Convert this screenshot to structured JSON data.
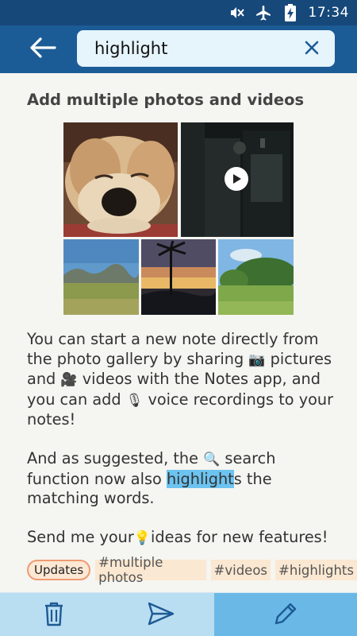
{
  "status_bar": {
    "time": "17:34",
    "icons": [
      "mute-icon",
      "airplane-mode-icon",
      "battery-charging-icon"
    ]
  },
  "search": {
    "value": "highlight",
    "back_icon": "arrow-left-icon",
    "clear_icon": "close-icon"
  },
  "note": {
    "title": "Add multiple photos and videos",
    "photos": [
      "dog-photo",
      "video-thumbnail",
      "mountain-landscape-photo",
      "sunset-palm-photo",
      "tropical-field-photo"
    ],
    "paragraph1": {
      "a": "You can start a new note directly from the photo gallery by sharing ",
      "camera_emoji": "📷",
      "b": " pictures and ",
      "film_emoji": "🎥",
      "c": " videos with the Notes app, and you can add ",
      "mic_emoji": "🎙",
      "d": " voice recordings to your notes!"
    },
    "paragraph2": {
      "a": "And as suggested, the ",
      "search_emoji": "🔍",
      "b": " search function now also ",
      "highlight": "highlight",
      "c": "s the matching words."
    },
    "paragraph3": {
      "a": "Send me your",
      "bulb_emoji": "💡",
      "b": "ideas for new features!"
    },
    "tags": [
      "Updates",
      "#multiple photos",
      "#videos",
      "#highlights"
    ]
  },
  "bottom_bar": {
    "icons": [
      "trash-icon",
      "send-icon",
      "pencil-icon"
    ]
  },
  "colors": {
    "status_bar": "#16487a",
    "app_bar": "#1c5c96",
    "search_box": "#e6f4fb",
    "highlight": "#6cc3f0",
    "tag_bg": "#fbe8d2",
    "bottom_bar": "#b9def2",
    "bottom_active": "#6ab8e6"
  }
}
